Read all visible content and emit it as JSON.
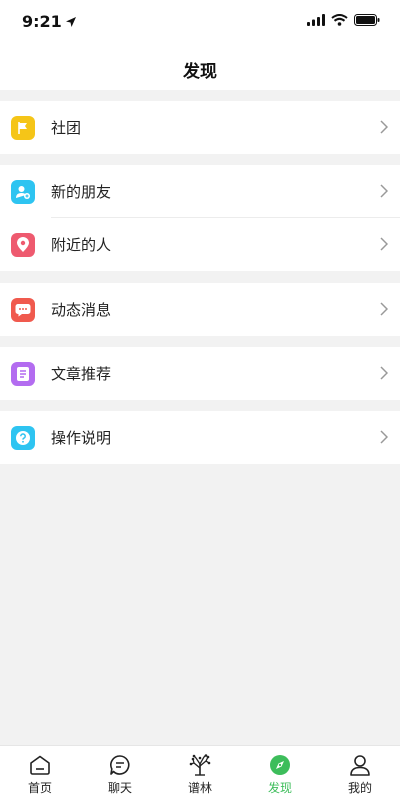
{
  "status_bar": {
    "time": "9:21"
  },
  "nav": {
    "title": "发现"
  },
  "groups": [
    [
      {
        "label": "社团",
        "icon": "flag-icon",
        "color": "#f5c518"
      }
    ],
    [
      {
        "label": "新的朋友",
        "icon": "add-friend-icon",
        "color": "#2ec4f1"
      },
      {
        "label": "附近的人",
        "icon": "location-pin-icon",
        "color": "#ee5a6f"
      }
    ],
    [
      {
        "label": "动态消息",
        "icon": "chat-bubble-icon",
        "color": "#f05a4e"
      }
    ],
    [
      {
        "label": "文章推荐",
        "icon": "document-icon",
        "color": "#b36cf0"
      }
    ],
    [
      {
        "label": "操作说明",
        "icon": "help-icon",
        "color": "#2ec4f1"
      }
    ]
  ],
  "tabs": [
    {
      "label": "首页",
      "icon": "home-icon",
      "active": false
    },
    {
      "label": "聊天",
      "icon": "chat-icon",
      "active": false
    },
    {
      "label": "谱林",
      "icon": "tree-icon",
      "active": false
    },
    {
      "label": "发现",
      "icon": "compass-icon",
      "active": true
    },
    {
      "label": "我的",
      "icon": "person-icon",
      "active": false
    }
  ],
  "colors": {
    "accent": "#3dbd5b",
    "background": "#f2f2f2"
  }
}
